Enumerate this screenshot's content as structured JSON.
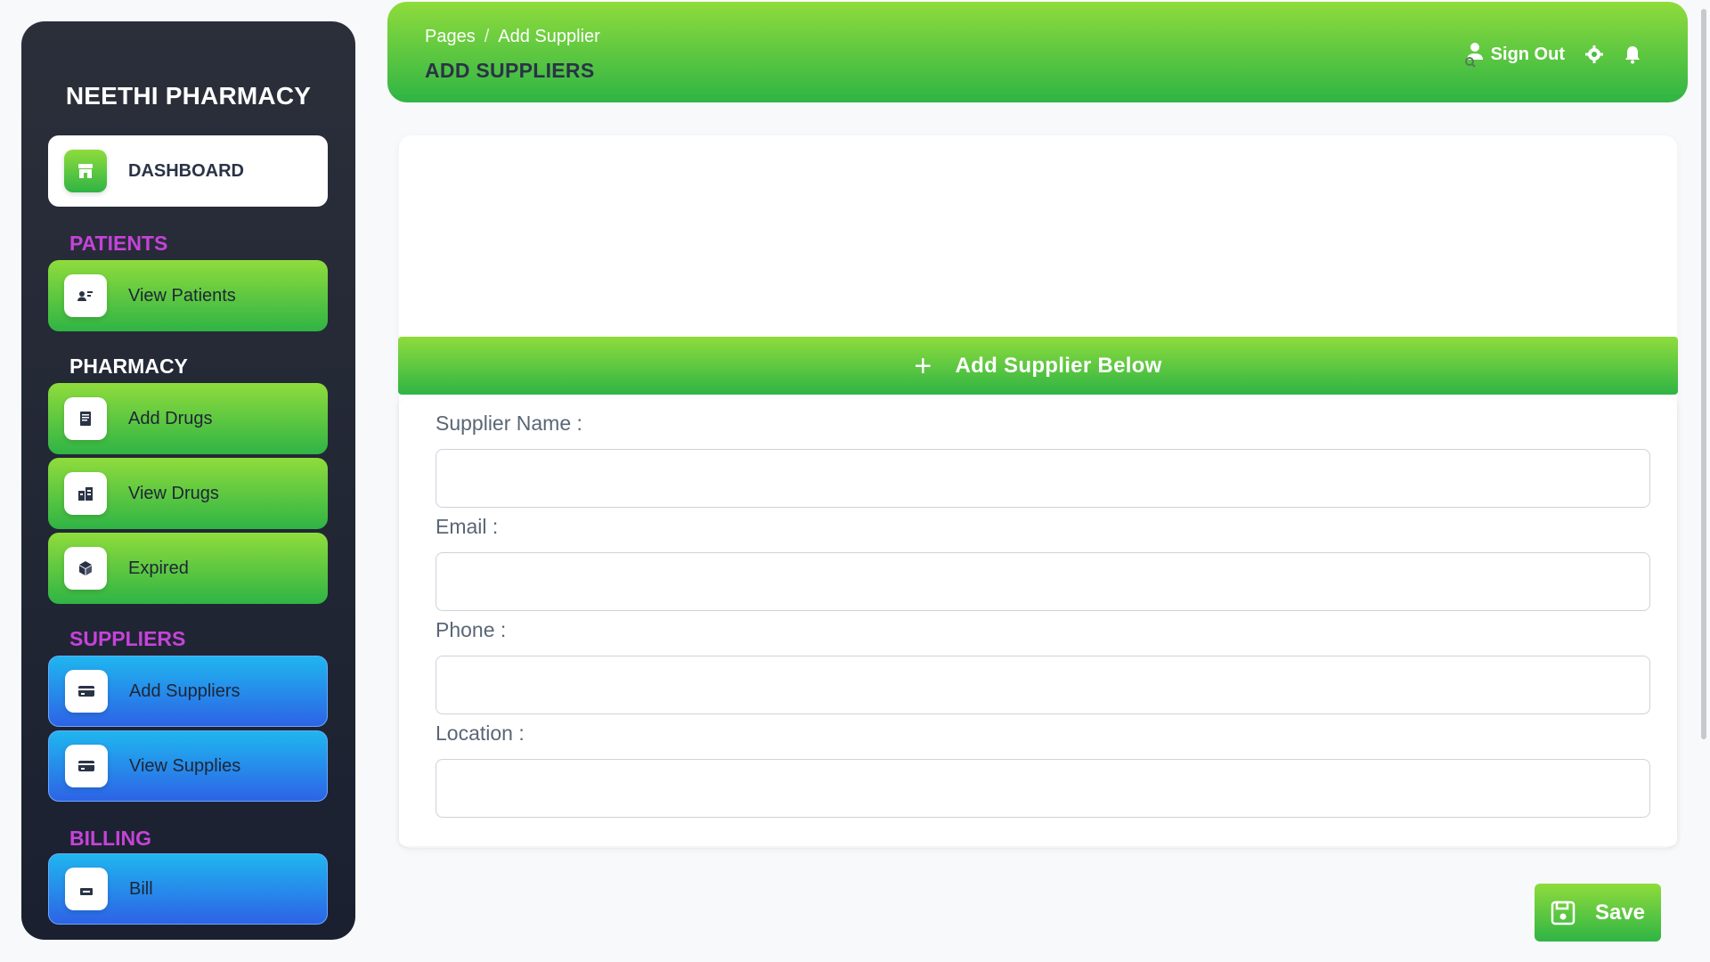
{
  "sidebar": {
    "brand": "NEETHI PHARMACY",
    "dashboard": {
      "label": "DASHBOARD",
      "icon": "store-icon"
    },
    "sections": {
      "patients": "PATIENTS",
      "pharmacy": "PHARMACY",
      "suppliers": "SUPPLIERS",
      "billing": "BILLING"
    },
    "items": {
      "view_patients": {
        "label": "View Patients",
        "icon": "user-card-icon"
      },
      "add_drugs": {
        "label": "Add Drugs",
        "icon": "document-icon"
      },
      "view_drugs": {
        "label": "View Drugs",
        "icon": "building-icon"
      },
      "expired": {
        "label": "Expired",
        "icon": "box-icon"
      },
      "add_suppliers": {
        "label": "Add Suppliers",
        "icon": "card-icon"
      },
      "view_supplies": {
        "label": "View Supplies",
        "icon": "card-icon"
      },
      "bill": {
        "label": "Bill",
        "icon": "bill-icon"
      }
    }
  },
  "header": {
    "breadcrumb": {
      "root": "Pages",
      "separator": "/",
      "current": "Add Supplier"
    },
    "title": "ADD SUPPLIERS",
    "signout_label": "Sign Out"
  },
  "form": {
    "banner": "Add Supplier Below",
    "fields": {
      "supplier_name": {
        "label": "Supplier Name :",
        "value": ""
      },
      "email": {
        "label": "Email :",
        "value": ""
      },
      "phone": {
        "label": "Phone :",
        "value": ""
      },
      "location": {
        "label": "Location :",
        "value": ""
      }
    },
    "save_label": "Save"
  },
  "colors": {
    "sidebar_bg": "#1e2433",
    "green_start": "#8fdc3c",
    "green_end": "#2fb445",
    "blue_start": "#1fb6ef",
    "blue_end": "#2d63e6",
    "section_purple": "#c543d9"
  }
}
